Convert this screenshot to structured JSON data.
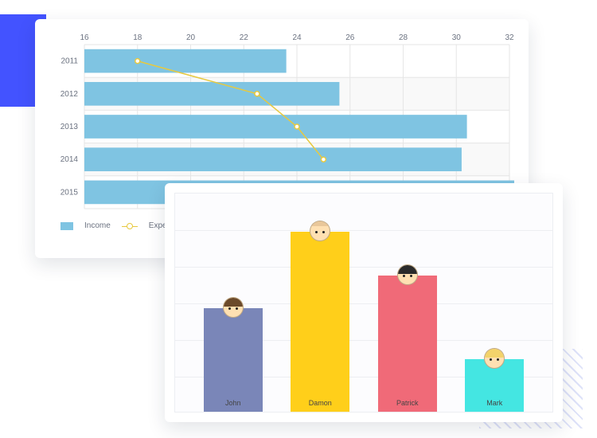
{
  "chart_data": [
    {
      "id": "A",
      "type": "bar",
      "orientation": "horizontal",
      "categories": [
        "2011",
        "2012",
        "2013",
        "2014",
        "2015"
      ],
      "series": [
        {
          "name": "Income",
          "values": [
            23.6,
            25.6,
            30.4,
            30.2,
            null
          ],
          "color": "#7fc4e2",
          "kind": "bar"
        },
        {
          "name": "Expenses",
          "values": [
            18.0,
            22.5,
            24.0,
            25.0,
            null
          ],
          "color": "#e7c93f",
          "kind": "line"
        }
      ],
      "xlim": [
        16,
        32
      ],
      "xticks": [
        16,
        18,
        20,
        22,
        24,
        26,
        28,
        30,
        32
      ],
      "legend": [
        "Income",
        "Expenses"
      ],
      "note": "2015 bar extends beyond visible card; Expenses line shows 4 points"
    },
    {
      "id": "B",
      "type": "bar",
      "categories": [
        "John",
        "Damon",
        "Patrick",
        "Mark"
      ],
      "values": [
        47,
        82,
        62,
        24
      ],
      "colors": [
        "#7a86b8",
        "#ffcf1a",
        "#f06a78",
        "#44e6e2"
      ],
      "ylim": [
        0,
        100
      ],
      "grid": true
    }
  ],
  "chartA": {
    "legend_income": "Income",
    "legend_expenses": "Expenses"
  },
  "chartB": {
    "labels": {
      "0": "John",
      "1": "Damon",
      "2": "Patrick",
      "3": "Mark"
    }
  }
}
